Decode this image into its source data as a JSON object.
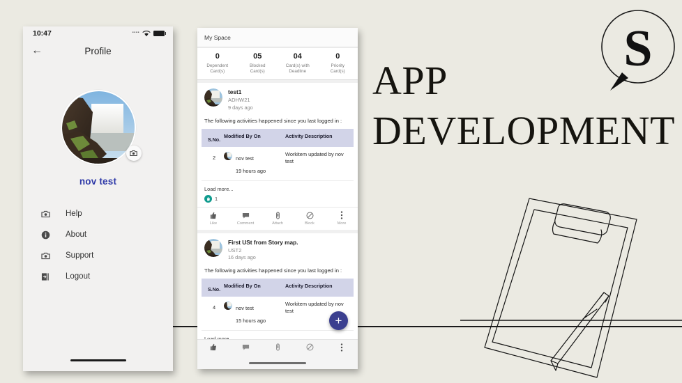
{
  "banner": {
    "title_line1": "APP",
    "title_line2": "DEVELOPMENT",
    "logo_letter": "S",
    "background_color": "#ebeae2",
    "accent_color": "#3b3f8f"
  },
  "left_phone": {
    "status": {
      "time": "10:47",
      "signal": "signal-dots-icon",
      "wifi": "wifi-icon",
      "battery": "battery-icon"
    },
    "appbar": {
      "back": "back-arrow-icon",
      "title": "Profile"
    },
    "avatar": {
      "alt": "waterfall-landscape-photo",
      "camera_button": "camera-icon"
    },
    "profile_name": "nov test",
    "name_color": "#2f3aa8",
    "menu": [
      {
        "icon": "camera-icon",
        "label": "Help"
      },
      {
        "icon": "info-icon",
        "label": "About"
      },
      {
        "icon": "camera-icon",
        "label": "Support"
      },
      {
        "icon": "logout-icon",
        "label": "Logout"
      }
    ]
  },
  "right_phone": {
    "header_title": "My Space",
    "stats": [
      {
        "num": "0",
        "label_line1": "Dependent",
        "label_line2": "Card(s)"
      },
      {
        "num": "05",
        "label_line1": "Blocked",
        "label_line2": "Card(s)"
      },
      {
        "num": "04",
        "label_line1": "Card(s) with",
        "label_line2": "Deadline"
      },
      {
        "num": "0",
        "label_line1": "Priority",
        "label_line2": "Card(s)"
      }
    ],
    "table_header": {
      "col1": "S.No.",
      "col2": "Modified By On",
      "col3": "Activity Description"
    },
    "table_header_color": "#d2d4e8",
    "load_more": "Load more...",
    "actions": [
      {
        "icon": "thumbs-up-icon",
        "label": "Like"
      },
      {
        "icon": "comment-icon",
        "label": "Comment"
      },
      {
        "icon": "attach-icon",
        "label": "Attach"
      },
      {
        "icon": "block-icon",
        "label": "Block"
      },
      {
        "icon": "more-icon",
        "label": "More"
      }
    ],
    "fab_label": "+",
    "cards": [
      {
        "title": "test1",
        "code": "ADHW21",
        "age": "9 days ago",
        "body": "The following activities happened since you last logged in :",
        "row": {
          "sno": "2",
          "user": "nov test",
          "when": "19 hours ago",
          "description": "Workitem updated by nov test"
        },
        "like_count": "1"
      },
      {
        "title": "First USt from Story map.",
        "code": "UST2",
        "age": "16 days ago",
        "body": "The following activities happened since you last logged in :",
        "row": {
          "sno": "4",
          "user": "nov test",
          "when": "15 hours ago",
          "description": "Workitem updated by nov test"
        },
        "like_count": ""
      }
    ]
  }
}
